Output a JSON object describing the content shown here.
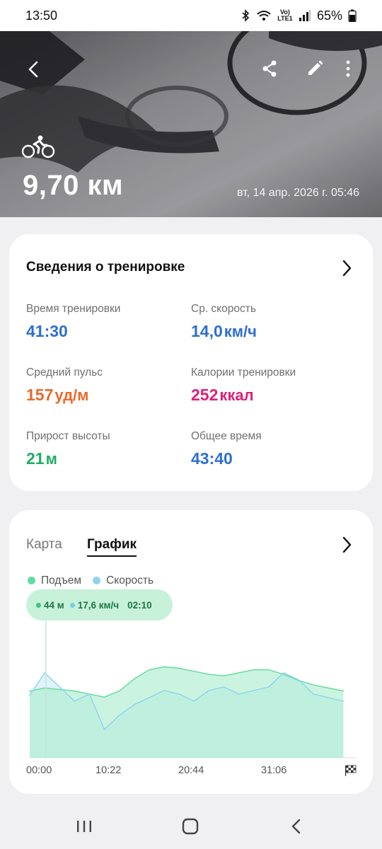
{
  "status_bar": {
    "time": "13:50",
    "network_label": "Vo) LTE1",
    "battery_percent": "65%",
    "icons": [
      "bluetooth-icon",
      "wifi-icon",
      "signal-icon",
      "battery-icon"
    ]
  },
  "workout": {
    "activity_icon": "cycling-icon",
    "distance": "9,70 км",
    "datetime": "вт, 14 апр. 2026 г. 05:46"
  },
  "summary": {
    "title": "Сведения о тренировке",
    "metrics": [
      {
        "label": "Время тренировки",
        "value": "41:30",
        "unit": ""
      },
      {
        "label": "Ср. скорость",
        "value": "14,0",
        "unit": "км/ч"
      },
      {
        "label": "Средний пульс",
        "value": "157",
        "unit": "уд/м"
      },
      {
        "label": "Калории тренировки",
        "value": "252",
        "unit": "ккал"
      },
      {
        "label": "Прирост высоты",
        "value": "21",
        "unit": "м"
      },
      {
        "label": "Общее время",
        "value": "43:40",
        "unit": ""
      }
    ]
  },
  "chart_card": {
    "tabs": [
      "Карта",
      "График"
    ],
    "active_tab": "График",
    "legend": {
      "elevation": "Подъем",
      "speed": "Скорость"
    },
    "tooltip": {
      "elevation": "44 м",
      "speed": "17,6 км/ч",
      "time": "02:10"
    },
    "x_labels": [
      "00:00",
      "10:22",
      "20:44",
      "31:06"
    ],
    "end_icon": "finish-flag-icon"
  },
  "colors": {
    "blue": "#2f6fcf",
    "orange": "#ea6a2c",
    "pink": "#e0207a",
    "green": "#1eae62",
    "elevation_fill": "#a8eccb",
    "speed_line": "#8fd3ee"
  },
  "chart_data": {
    "type": "area",
    "x_label_ticks": [
      "00:00",
      "10:22",
      "20:44",
      "31:06"
    ],
    "x_minutes": [
      0,
      2,
      4,
      6,
      8,
      10,
      12,
      14,
      16,
      18,
      20,
      22,
      24,
      26,
      28,
      30,
      32,
      34,
      36,
      38,
      40,
      42
    ],
    "series": [
      {
        "name": "Подъем",
        "unit": "м",
        "values": [
          44,
          46,
          45,
          44,
          42,
          40,
          44,
          52,
          58,
          60,
          59,
          57,
          55,
          54,
          56,
          58,
          58,
          55,
          51,
          48,
          46,
          44
        ]
      },
      {
        "name": "Скорость",
        "unit": "км/ч",
        "values": [
          17.6,
          24,
          20,
          16,
          18,
          8,
          12,
          15,
          17,
          19,
          18,
          16,
          19,
          20,
          18,
          19,
          20,
          24,
          22,
          18,
          17,
          16
        ]
      }
    ],
    "marker": {
      "time": "02:10",
      "elevation": 44,
      "speed": 17.6
    }
  },
  "navbar": {
    "icons": [
      "recents-icon",
      "home-icon",
      "back-icon"
    ]
  }
}
